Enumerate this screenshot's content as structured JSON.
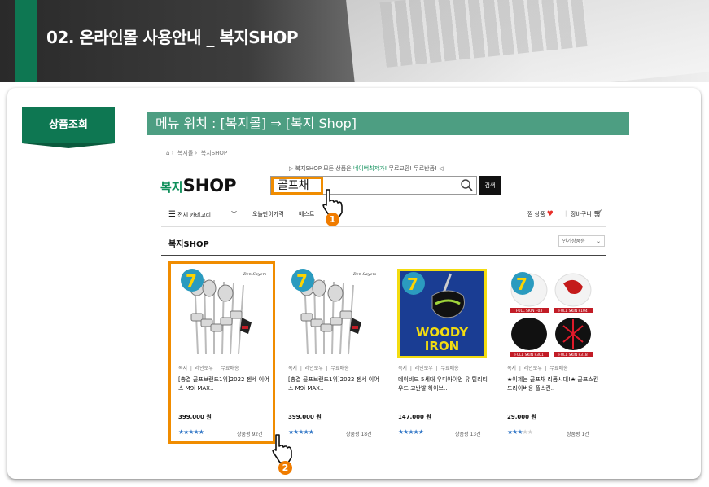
{
  "header": {
    "title": "02. 온라인몰 사용안내 _ 복지SHOP"
  },
  "section_tag": "상품조회",
  "menu_location": "메뉴 위치 : [복지몰] ⇒ [복지 Shop]",
  "shop": {
    "breadcrumb": [
      "복지몰",
      "복지SHOP"
    ],
    "notice_prefix": "▷ 복지SHOP 모든 상품은",
    "notice_highlight": "네이버최저가!",
    "notice_suffix": "무료교환! 무료반품! ◁",
    "logo_prefix": "복지",
    "logo_main": "SHOP",
    "search_value": "골프채",
    "search_button": "검색",
    "nav": {
      "all_categories": "전체 카테고리",
      "today_price": "오늘만이가격",
      "best": "베스트",
      "wishlist": "찜 상품",
      "cart": "장바구니"
    },
    "section_title": "복지SHOP",
    "sort_label": "인기상품순",
    "products": [
      {
        "meta": [
          "복지",
          "레인보우",
          "무료배송"
        ],
        "name": "[총결 골프브랜드1위]2022 젠세 이어스 M9i MAX..",
        "price": "399,000 원",
        "rating": 5,
        "reviews": "상품평 92건",
        "image": "golf-club-set"
      },
      {
        "meta": [
          "복지",
          "레인보우",
          "무료배송"
        ],
        "name": "[총결 골프브랜드1위]2022 젠세 이어스 M9i MAX..",
        "price": "399,000 원",
        "rating": 5,
        "reviews": "상품평 18건",
        "image": "golf-club-set"
      },
      {
        "meta": [
          "복지",
          "레인보우",
          "무료배송"
        ],
        "name": "데이비드 5세대 우디아이언 유 틸리티 우드 고반발 하이브..",
        "price": "147,000 원",
        "rating": 5,
        "reviews": "상품평 13건",
        "image": "woody-iron",
        "image_text": [
          "WOODY",
          "IRON"
        ]
      },
      {
        "meta": [
          "복지",
          "레인보우",
          "무료배송"
        ],
        "name": "★이제는 골프채 리폼시대!★ 골프스킨 드라이버용 풀스킨..",
        "price": "29,000 원",
        "rating": 3,
        "reviews": "상품평 1건",
        "image": "club-skins",
        "image_text": [
          "FULL SKIN F03",
          "FULL SKIN F104",
          "FULL SKIN F301",
          "FULL SKIN F318"
        ]
      }
    ]
  },
  "steps": [
    "1",
    "2"
  ],
  "colors": {
    "brand_green": "#0e7752",
    "menu_green": "#4d9e82",
    "highlight_orange": "#f08c00",
    "star_blue": "#2b72c4"
  }
}
